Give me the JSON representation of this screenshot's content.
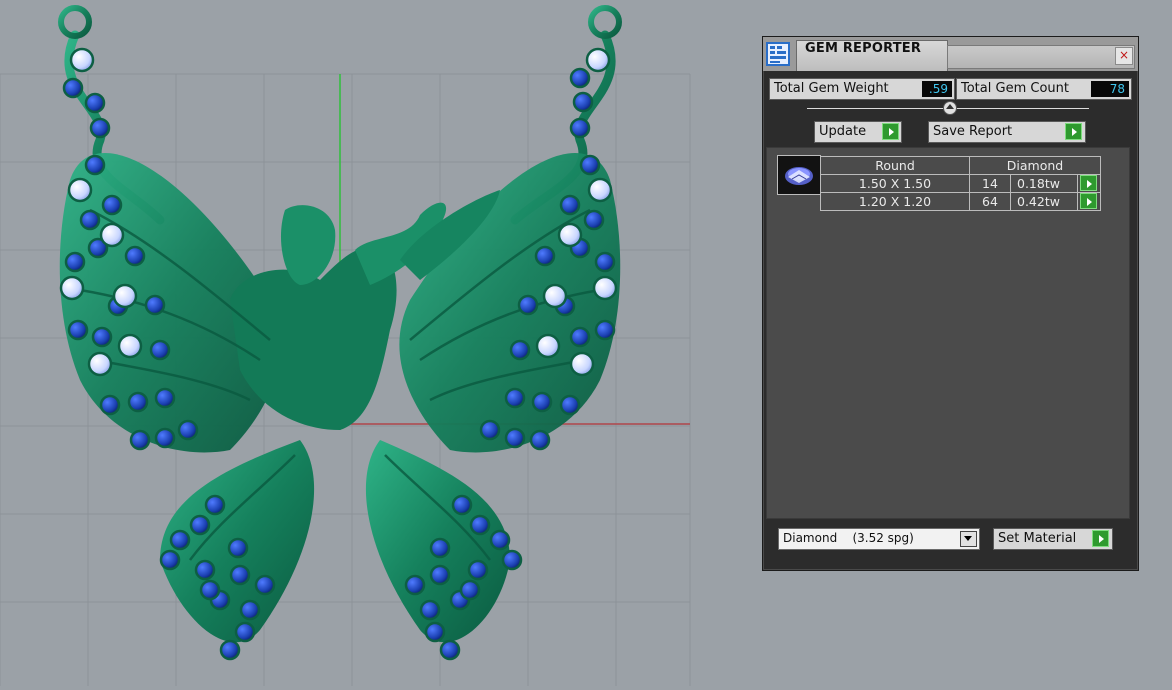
{
  "gem_reporter": {
    "title": "GEM REPORTER",
    "close_label": "×",
    "total_gem_weight_label": "Total Gem Weight",
    "total_gem_weight_value": ".59",
    "total_gem_count_label": "Total Gem Count",
    "total_gem_count_value": "78",
    "update_label": "Update",
    "save_report_label": "Save Report",
    "table": {
      "headers": [
        "Round",
        "Diamond"
      ],
      "rows": [
        {
          "size": "1.50 X 1.50",
          "count": "14",
          "weight": "0.18tw"
        },
        {
          "size": "1.20 X 1.20",
          "count": "64",
          "weight": "0.42tw"
        }
      ]
    },
    "material_select": "Diamond    (3.52 spg)",
    "set_material_label": "Set Material"
  },
  "colors": {
    "viewport_bg": "#9ba1a7",
    "model_green": "#1f8a64",
    "gem_blue": "#1a3fb0",
    "gem_white": "#dbe4ff",
    "axis_green": "#2fbf3c",
    "axis_red": "#b0464a",
    "value_text": "#3fc6ef",
    "go_button": "#2e9a2e"
  }
}
